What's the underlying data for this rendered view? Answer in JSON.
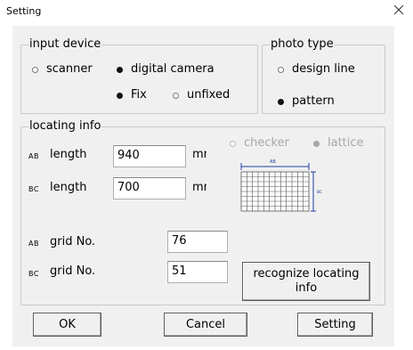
{
  "window": {
    "title": "Setting",
    "close_icon": "close-icon"
  },
  "input_device": {
    "legend": "input device",
    "scanner": "scanner",
    "digital_camera": "digital camera",
    "selected": "digital camera",
    "fix": "Fix",
    "unfixed": "unfixed",
    "selected_mode": "Fix"
  },
  "photo_type": {
    "legend": "photo type",
    "design_line": "design line",
    "pattern": "pattern",
    "selected": "pattern"
  },
  "locating_info": {
    "legend": "locating info",
    "checker": "checker",
    "lattice": "lattice",
    "selected": "lattice",
    "ab_tag": "AB",
    "bc_tag": "BC",
    "length_label": "length",
    "ab_length": "940",
    "bc_length": "700",
    "unit": "mm",
    "grid_label": "grid No.",
    "ab_grid": "76",
    "bc_grid": "51",
    "diagram_ab": "AB",
    "diagram_bc": "BC",
    "recognize_button": "recognize locating info"
  },
  "buttons": {
    "ok": "OK",
    "cancel": "Cancel",
    "setting": "Setting"
  },
  "colors": {
    "diagram_accent": "#2040a0",
    "grid_line": "#555555"
  }
}
